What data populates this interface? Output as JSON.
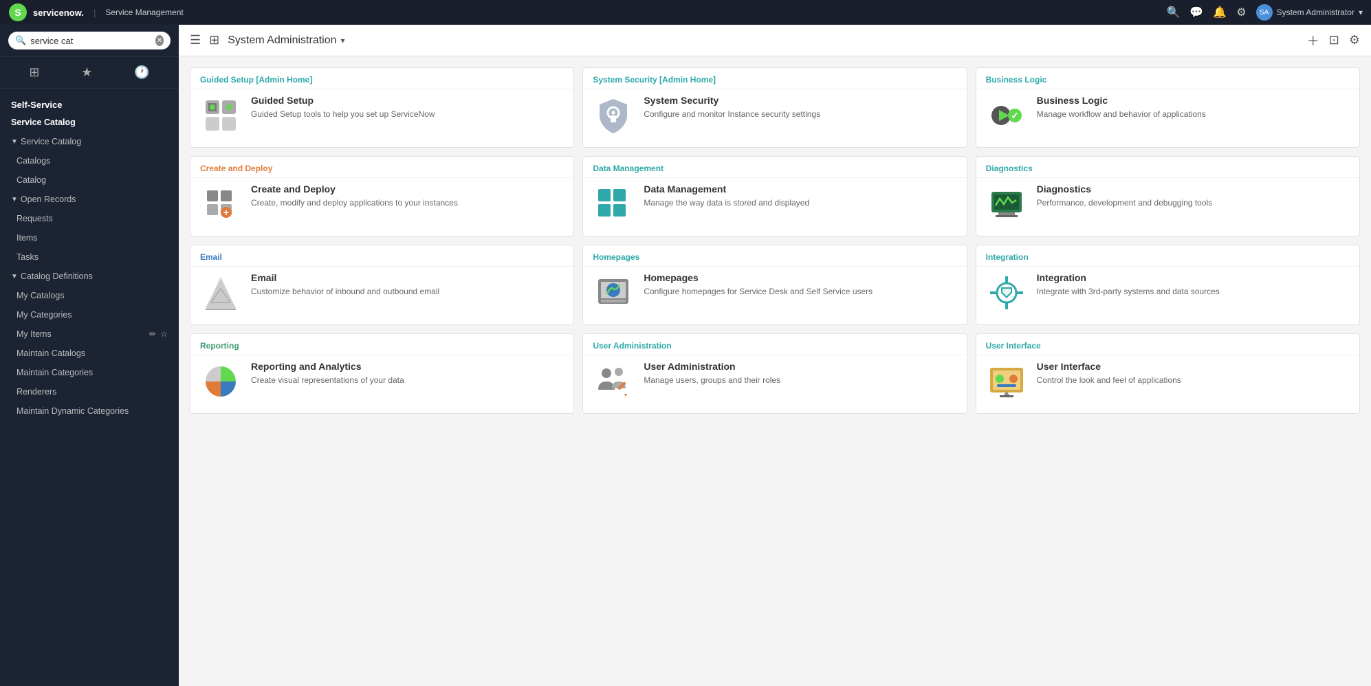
{
  "topbar": {
    "logo_text": "servicenow.",
    "app_name": "Service Management",
    "user_name": "System Administrator",
    "user_initials": "SA"
  },
  "search": {
    "value": "service cat",
    "placeholder": "service cat"
  },
  "header": {
    "title": "System Administration",
    "plus_label": "+",
    "share_label": "⊡",
    "settings_label": "⚙"
  },
  "sidebar": {
    "sections": [
      {
        "label": "Self-Service",
        "type": "header"
      },
      {
        "label": "Service Catalog",
        "type": "item-bold",
        "indent": false
      },
      {
        "label": "Service Catalog",
        "type": "group-header"
      },
      {
        "label": "Catalogs",
        "type": "item"
      },
      {
        "label": "Catalog",
        "type": "item"
      },
      {
        "label": "Open Records",
        "type": "group-header"
      },
      {
        "label": "Requests",
        "type": "item"
      },
      {
        "label": "Items",
        "type": "item"
      },
      {
        "label": "Tasks",
        "type": "item"
      },
      {
        "label": "Catalog Definitions",
        "type": "group-header"
      },
      {
        "label": "My Catalogs",
        "type": "item"
      },
      {
        "label": "My Categories",
        "type": "item"
      },
      {
        "label": "My Items",
        "type": "item",
        "show_icons": true
      },
      {
        "label": "Maintain Catalogs",
        "type": "item"
      },
      {
        "label": "Maintain Categories",
        "type": "item"
      },
      {
        "label": "Renderers",
        "type": "item"
      },
      {
        "label": "Maintain Dynamic Categories",
        "type": "item"
      }
    ]
  },
  "cards": [
    {
      "section": "Guided Setup [Admin Home]",
      "section_color": "teal",
      "title": "Guided Setup",
      "description": "Guided Setup tools to help you set up ServiceNow",
      "icon_type": "guided-setup"
    },
    {
      "section": "System Security [Admin Home]",
      "section_color": "teal",
      "title": "System Security",
      "description": "Configure and monitor Instance security settings",
      "icon_type": "system-security"
    },
    {
      "section": "Business Logic",
      "section_color": "teal",
      "title": "Business Logic",
      "description": "Manage workflow and behavior of applications",
      "icon_type": "business-logic"
    },
    {
      "section": "Create and Deploy",
      "section_color": "orange",
      "title": "Create and Deploy",
      "description": "Create, modify and deploy applications to your instances",
      "icon_type": "create-deploy"
    },
    {
      "section": "Data Management",
      "section_color": "teal",
      "title": "Data Management",
      "description": "Manage the way data is stored and displayed",
      "icon_type": "data-management"
    },
    {
      "section": "Diagnostics",
      "section_color": "teal",
      "title": "Diagnostics",
      "description": "Performance, development and debugging tools",
      "icon_type": "diagnostics"
    },
    {
      "section": "Email",
      "section_color": "blue",
      "title": "Email",
      "description": "Customize behavior of inbound and outbound email",
      "icon_type": "email"
    },
    {
      "section": "Homepages",
      "section_color": "teal",
      "title": "Homepages",
      "description": "Configure homepages for Service Desk and Self Service users",
      "icon_type": "homepages"
    },
    {
      "section": "Integration",
      "section_color": "teal",
      "title": "Integration",
      "description": "Integrate with 3rd-party systems and data sources",
      "icon_type": "integration"
    },
    {
      "section": "Reporting",
      "section_color": "green",
      "title": "Reporting and Analytics",
      "description": "Create visual representations of your data",
      "icon_type": "reporting"
    },
    {
      "section": "User Administration",
      "section_color": "teal",
      "title": "User Administration",
      "description": "Manage users, groups and their roles",
      "icon_type": "user-admin"
    },
    {
      "section": "User Interface",
      "section_color": "teal",
      "title": "User Interface",
      "description": "Control the look and feel of applications",
      "icon_type": "user-interface"
    }
  ]
}
